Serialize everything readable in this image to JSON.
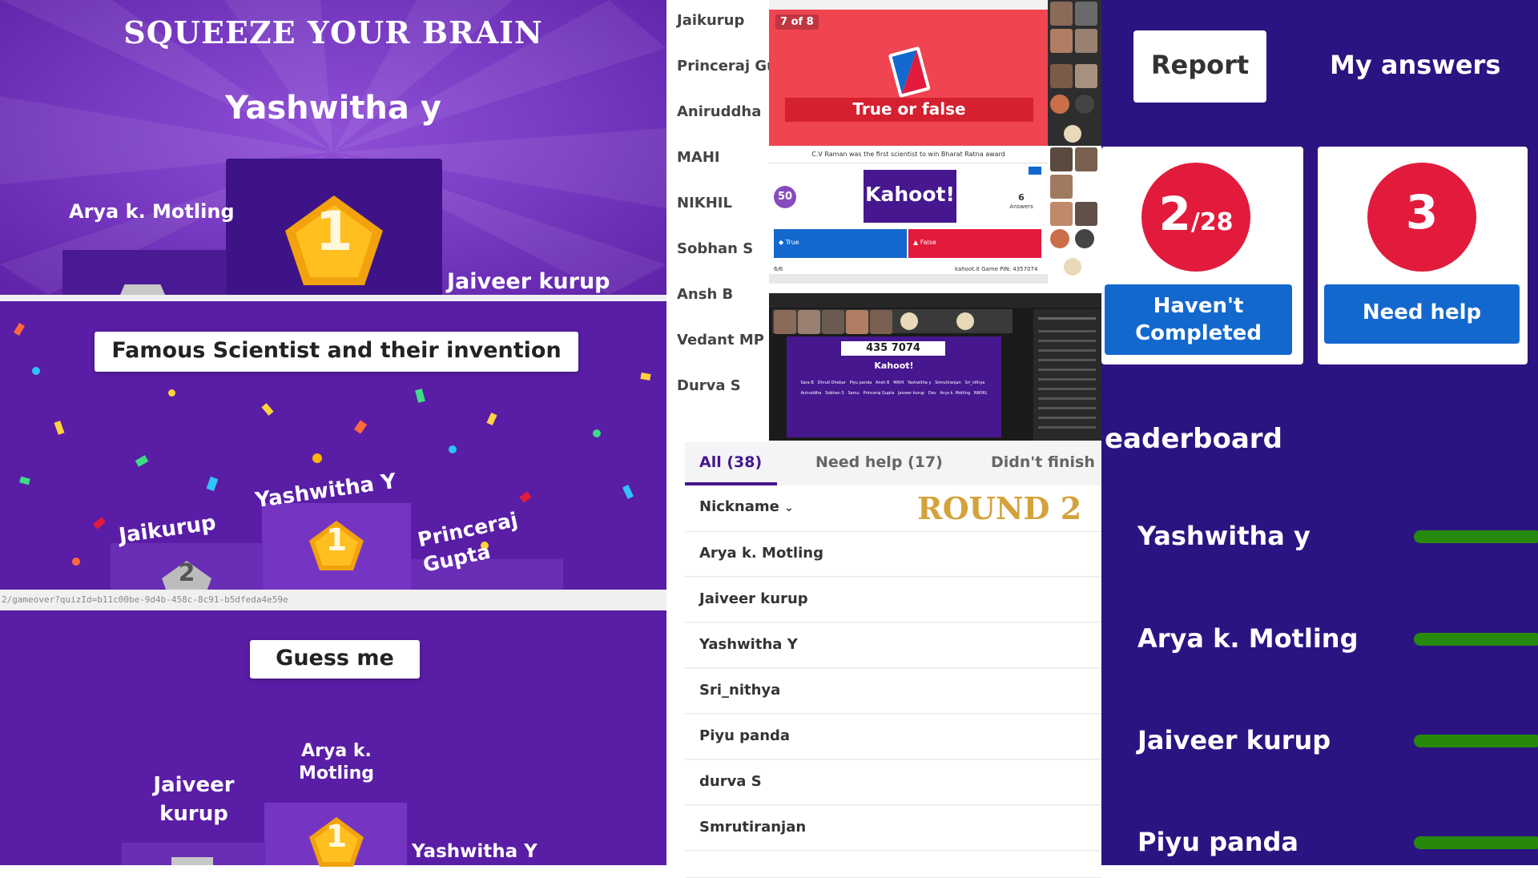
{
  "squeeze": {
    "title": "SQUEEZE YOUR BRAIN",
    "winner": "Yashwitha y",
    "first_place_rank": "1",
    "second_place": "Arya k. Motling",
    "third_place": "Jaiveer kurup"
  },
  "scientist": {
    "title": "Famous Scientist and their invention",
    "first": "Yashwitha Y",
    "first_rank": "1",
    "second": "Jaikurup",
    "second_rank": "2",
    "third": "Princeraj Gupta"
  },
  "url_text": "2/gameover?quizId=b11c00be-9d4b-458c-8c91-b5dfeda4e59e",
  "guess": {
    "title": "Guess me",
    "first": "Arya k. Motling",
    "first_rank": "1",
    "second": "Jaiveer kurup",
    "third": "Yashwitha Y"
  },
  "participants": [
    "Jaikurup",
    "Princeraj Gup",
    "Aniruddha",
    "MAHI",
    "NIKHIL",
    "Sobhan S",
    "Ansh B",
    "Vedant MP",
    "Durva S"
  ],
  "quiz_screen": {
    "counter": "7 of 8",
    "question_type": "True or false"
  },
  "question_screen": {
    "question": "C.V Raman was the first scientist to win Bharat Ratna award",
    "timer": "50",
    "logo": "Kahoot!",
    "answers_count": "6",
    "answers_label": "Answers",
    "true_label": "True",
    "false_label": "False",
    "progress": "6/6",
    "footer": "kahoot.it Game PIN: 4357074"
  },
  "lobby_screen": {
    "pin": "435 7074",
    "logo": "Kahoot!",
    "players": [
      "Sara B",
      "Dhruti Dhekar",
      "Piyu panda",
      "Ansh B",
      "MAHI",
      "Yashwitha y",
      "Smrutiranjan",
      "Sri_nithya",
      "Aniruddha",
      "Sobhan S",
      "Samu",
      "Princeraj Gupta",
      "Jaiveer kurup",
      "Dev",
      "Arya k. Motling",
      "NIKHIL"
    ]
  },
  "report_list": {
    "tabs": [
      "All (38)",
      "Need help (17)",
      "Didn't finish"
    ],
    "sort_label": "Nickname",
    "round_label": "ROUND 2",
    "rows": [
      "Arya k. Motling",
      "Jaiveer kurup",
      "Yashwitha Y",
      "Sri_nithya",
      "Piyu panda",
      "durva S",
      "Smrutiranjan"
    ]
  },
  "summary": {
    "report_button": "Report",
    "answers_tab": "My answers",
    "incomplete_count": "2",
    "incomplete_total": "/28",
    "incomplete_label": "Haven't Completed",
    "help_count": "3",
    "help_label": "Need help",
    "leaderboard_title": "eaderboard",
    "leaders": [
      "Yashwitha y",
      "Arya k. Motling",
      "Jaiveer kurup",
      "Piyu panda"
    ]
  },
  "colors": {
    "kahoot_purple": "#46178f",
    "red": "#e21b3c",
    "blue": "#1368ce",
    "green": "#26890c"
  }
}
